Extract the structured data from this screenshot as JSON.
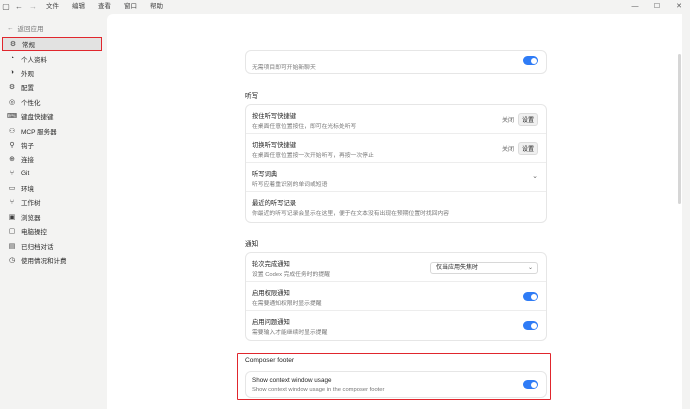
{
  "titlebar": {
    "menu": [
      "文件",
      "编辑",
      "查看",
      "窗口",
      "帮助"
    ],
    "controls": [
      "—",
      "☐",
      "✕"
    ]
  },
  "sidebar": {
    "back_label": "返回应用",
    "items": [
      {
        "label": "常规",
        "icon": "gear-icon",
        "glyph": "⚙"
      },
      {
        "label": "个人资料",
        "icon": "user-icon",
        "glyph": "◔"
      },
      {
        "label": "外观",
        "icon": "appearance-icon",
        "glyph": "◑"
      },
      {
        "label": "配置",
        "icon": "config-icon",
        "glyph": "⚙"
      },
      {
        "label": "个性化",
        "icon": "personalize-icon",
        "glyph": "◎"
      },
      {
        "label": "键盘快捷键",
        "icon": "keyboard-icon",
        "glyph": "⌨"
      },
      {
        "label": "MCP 服务器",
        "icon": "server-icon",
        "glyph": "⚇"
      },
      {
        "label": "钩子",
        "icon": "hook-icon",
        "glyph": "⚲"
      },
      {
        "label": "连接",
        "icon": "globe-icon",
        "glyph": "⊕"
      },
      {
        "label": "Git",
        "icon": "git-icon",
        "glyph": "⑂"
      },
      {
        "label": "环境",
        "icon": "environment-icon",
        "glyph": "▭"
      },
      {
        "label": "工作树",
        "icon": "worktree-icon",
        "glyph": "⑂"
      },
      {
        "label": "浏览器",
        "icon": "browser-icon",
        "glyph": "▣"
      },
      {
        "label": "电脑操控",
        "icon": "computer-icon",
        "glyph": "▢"
      },
      {
        "label": "已归档对话",
        "icon": "archive-icon",
        "glyph": "▤"
      },
      {
        "label": "使用情况和计费",
        "icon": "usage-icon",
        "glyph": "◷"
      }
    ]
  },
  "main": {
    "top_card": {
      "desc": "无需项目即可开始新聊天",
      "toggle": true
    },
    "dictation": {
      "title": "听写",
      "rows": [
        {
          "title": "按住听写快捷键",
          "desc": "在桌面任意位置按住，即可在光标处听写",
          "off_label": "关闭",
          "set_label": "设置"
        },
        {
          "title": "切换听写快捷键",
          "desc": "在桌面任意位置按一次开始听写，再按一次停止",
          "off_label": "关闭",
          "set_label": "设置"
        },
        {
          "title": "听写词典",
          "desc": "听写应着重识别的单词或短语"
        },
        {
          "title": "最近的听写记录",
          "desc": "你最近的听写记录会显示在这里，便于在文本没有出现在预期位置时找回内容"
        }
      ]
    },
    "notifications": {
      "title": "通知",
      "rows": [
        {
          "title": "轮次完成通知",
          "desc": "设置 Codex 完成任务时的提醒",
          "select_value": "仅当应用失焦时"
        },
        {
          "title": "启用权限通知",
          "desc": "在需要通知权限时显示提醒",
          "toggle": true
        },
        {
          "title": "启用问题通知",
          "desc": "需要输入才能继续时显示提醒",
          "toggle": true
        }
      ]
    },
    "composer_footer": {
      "title": "Composer footer",
      "row": {
        "title": "Show context window usage",
        "desc": "Show context window usage in the composer footer",
        "toggle": true
      }
    }
  },
  "colors": {
    "accent_toggle": "#2f7cf6",
    "highlight": "#e0262d"
  }
}
